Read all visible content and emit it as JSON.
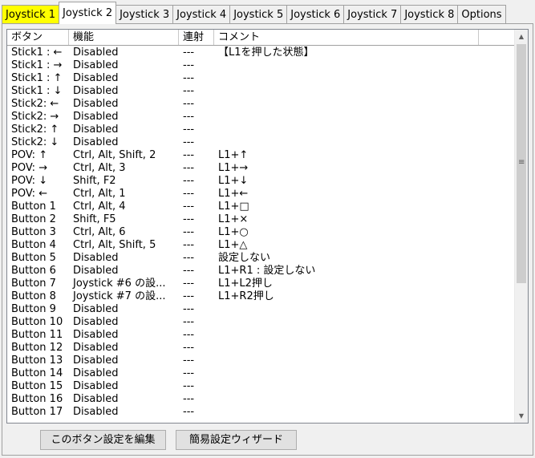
{
  "tabs": [
    {
      "label": "Joystick 1",
      "style": "yellow"
    },
    {
      "label": "Joystick 2",
      "style": "active"
    },
    {
      "label": "Joystick 3",
      "style": ""
    },
    {
      "label": "Joystick 4",
      "style": ""
    },
    {
      "label": "Joystick 5",
      "style": ""
    },
    {
      "label": "Joystick 6",
      "style": ""
    },
    {
      "label": "Joystick 7",
      "style": ""
    },
    {
      "label": "Joystick 8",
      "style": ""
    },
    {
      "label": "Options",
      "style": ""
    }
  ],
  "columns": [
    "ボタン",
    "機能",
    "連射",
    "コメント"
  ],
  "rows": [
    [
      "Stick1 : ←",
      "Disabled",
      "---",
      "【L1を押した状態】"
    ],
    [
      "Stick1 : →",
      "Disabled",
      "---",
      ""
    ],
    [
      "Stick1 : ↑",
      "Disabled",
      "---",
      ""
    ],
    [
      "Stick1 : ↓",
      "Disabled",
      "---",
      ""
    ],
    [
      "Stick2: ←",
      "Disabled",
      "---",
      ""
    ],
    [
      "Stick2: →",
      "Disabled",
      "---",
      ""
    ],
    [
      "Stick2: ↑",
      "Disabled",
      "---",
      ""
    ],
    [
      "Stick2: ↓",
      "Disabled",
      "---",
      ""
    ],
    [
      "POV: ↑",
      "Ctrl, Alt, Shift, 2",
      "---",
      "L1+↑"
    ],
    [
      "POV: →",
      "Ctrl, Alt, 3",
      "---",
      "L1+→"
    ],
    [
      "POV: ↓",
      "Shift, F2",
      "---",
      "L1+↓"
    ],
    [
      "POV: ←",
      "Ctrl, Alt, 1",
      "---",
      "L1+←"
    ],
    [
      "Button 1",
      "Ctrl, Alt, 4",
      "---",
      "L1+□"
    ],
    [
      "Button 2",
      "Shift, F5",
      "---",
      "L1+×"
    ],
    [
      "Button 3",
      "Ctrl, Alt, 6",
      "---",
      "L1+○"
    ],
    [
      "Button 4",
      "Ctrl, Alt, Shift, 5",
      "---",
      "L1+△"
    ],
    [
      "Button 5",
      "Disabled",
      "---",
      "設定しない"
    ],
    [
      "Button 6",
      "Disabled",
      "---",
      "L1+R1 : 設定しない"
    ],
    [
      "Button 7",
      "Joystick #6 の設...",
      "---",
      "L1+L2押し"
    ],
    [
      "Button 8",
      "Joystick #7 の設...",
      "---",
      "L1+R2押し"
    ],
    [
      "Button 9",
      "Disabled",
      "---",
      ""
    ],
    [
      "Button 10",
      "Disabled",
      "---",
      ""
    ],
    [
      "Button 11",
      "Disabled",
      "---",
      ""
    ],
    [
      "Button 12",
      "Disabled",
      "---",
      ""
    ],
    [
      "Button 13",
      "Disabled",
      "---",
      ""
    ],
    [
      "Button 14",
      "Disabled",
      "---",
      ""
    ],
    [
      "Button 15",
      "Disabled",
      "---",
      ""
    ],
    [
      "Button 16",
      "Disabled",
      "---",
      ""
    ],
    [
      "Button 17",
      "Disabled",
      "---",
      ""
    ]
  ],
  "buttons": {
    "edit": "このボタン設定を編集",
    "wizard": "簡易設定ウィザード"
  },
  "scrollbar": {
    "up_icon": "▲",
    "down_icon": "▼",
    "grip_icon": "≡"
  },
  "colors": {
    "tab_highlight": "#ffff00"
  }
}
